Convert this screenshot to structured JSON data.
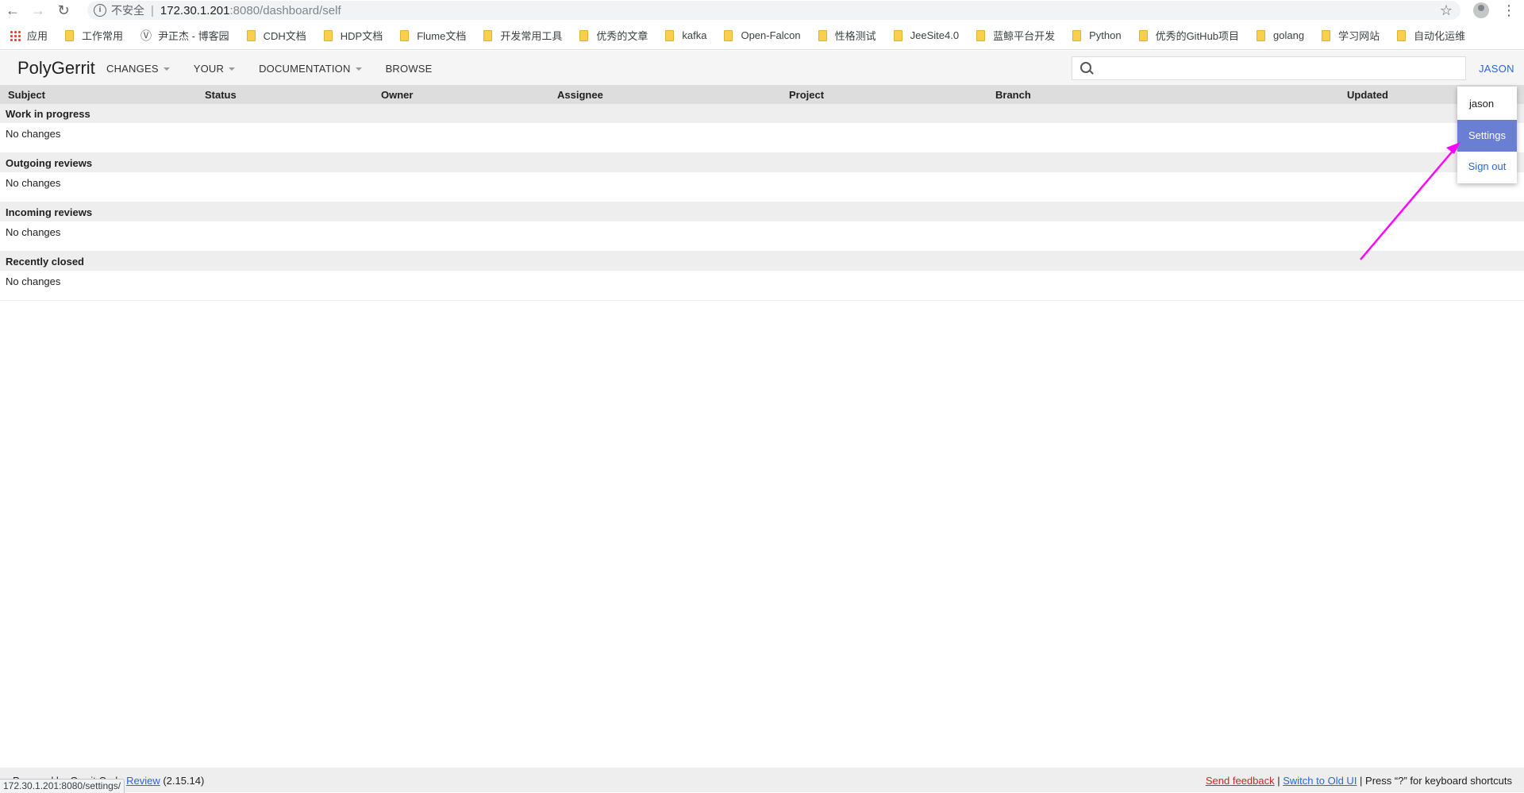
{
  "browser": {
    "insecure_label": "不安全",
    "url_host": "172.30.1.201",
    "url_rest": ":8080/dashboard/self",
    "status_url": "172.30.1.201:8080/settings/",
    "bookmarks": [
      {
        "label": "应用",
        "icon": "apps-grid-icon"
      },
      {
        "label": "工作常用",
        "icon": "folder-icon"
      },
      {
        "label": "尹正杰 - 博客园",
        "icon": "site-icon"
      },
      {
        "label": "CDH文档",
        "icon": "folder-icon"
      },
      {
        "label": "HDP文档",
        "icon": "folder-icon"
      },
      {
        "label": "Flume文档",
        "icon": "folder-icon"
      },
      {
        "label": "开发常用工具",
        "icon": "folder-icon"
      },
      {
        "label": "优秀的文章",
        "icon": "folder-icon"
      },
      {
        "label": "kafka",
        "icon": "folder-icon"
      },
      {
        "label": "Open-Falcon",
        "icon": "folder-icon"
      },
      {
        "label": "性格测试",
        "icon": "folder-icon"
      },
      {
        "label": "JeeSite4.0",
        "icon": "folder-icon"
      },
      {
        "label": "蓝鲸平台开发",
        "icon": "folder-icon"
      },
      {
        "label": "Python",
        "icon": "folder-icon"
      },
      {
        "label": "优秀的GitHub项目",
        "icon": "folder-icon"
      },
      {
        "label": "golang",
        "icon": "folder-icon"
      },
      {
        "label": "学习网站",
        "icon": "folder-icon"
      },
      {
        "label": "自动化运维",
        "icon": "folder-icon"
      }
    ]
  },
  "header": {
    "logo": "PolyGerrit",
    "nav": [
      {
        "label": "CHANGES",
        "has_dropdown": true
      },
      {
        "label": "YOUR",
        "has_dropdown": true
      },
      {
        "label": "DOCUMENTATION",
        "has_dropdown": true
      },
      {
        "label": "BROWSE",
        "has_dropdown": false
      }
    ],
    "search_placeholder": "",
    "search_value": "",
    "account_label": "JASON"
  },
  "table": {
    "columns": [
      "Subject",
      "Status",
      "Owner",
      "Assignee",
      "Project",
      "Branch",
      "Updated"
    ],
    "sections": [
      {
        "title": "Work in progress",
        "empty_text": "No changes"
      },
      {
        "title": "Outgoing reviews",
        "empty_text": "No changes"
      },
      {
        "title": "Incoming reviews",
        "empty_text": "No changes"
      },
      {
        "title": "Recently closed",
        "empty_text": "No changes"
      }
    ]
  },
  "account_dropdown": {
    "name": "jason",
    "settings_label": "Settings",
    "signout_label": "Sign out"
  },
  "footer": {
    "left_prefix": "Powered by Gerrit Code ",
    "left_link": "Review",
    "version": " (2.15.14)",
    "feedback_label": "Send feedback",
    "divider": " | ",
    "switch_label": "Switch to Old UI",
    "shortcuts_text": " | Press “?” for keyboard shortcuts"
  },
  "colors": {
    "accent_link": "#2a66d9",
    "dropdown_highlight": "#6a7ed4",
    "annotation_arrow": "#ff00ff",
    "feedback_link": "#c62828"
  }
}
